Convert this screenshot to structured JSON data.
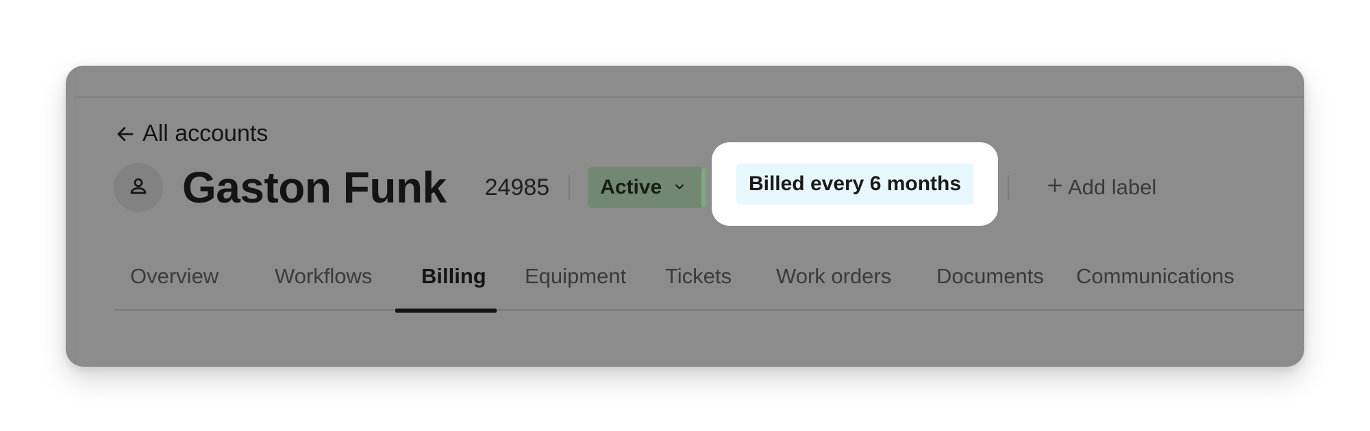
{
  "back_link": {
    "label": "All accounts",
    "icon": "arrow-left-icon"
  },
  "account": {
    "name": "Gaston Funk",
    "id": "24985",
    "avatar_icon": "user-icon"
  },
  "status": {
    "label": "Active",
    "icon": "chevron-down-icon",
    "color": "#738873"
  },
  "billing_badge": {
    "label": "Billed every 6 months",
    "color": "#e6f7fd"
  },
  "add_label": {
    "icon": "plus-icon",
    "label": "Add label"
  },
  "tabs": [
    {
      "label": "Overview"
    },
    {
      "label": "Workflows"
    },
    {
      "label": "Billing",
      "active": true
    },
    {
      "label": "Equipment"
    },
    {
      "label": "Tickets"
    },
    {
      "label": "Work orders"
    },
    {
      "label": "Documents"
    },
    {
      "label": "Communications"
    }
  ],
  "colors": {
    "overlay": "#8c8c8c",
    "text_primary": "#141414"
  }
}
